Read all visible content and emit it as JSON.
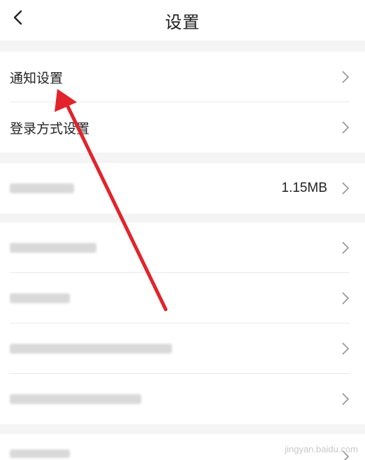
{
  "header": {
    "title": "设置",
    "back_icon": "chevron-left-icon"
  },
  "group1": {
    "items": [
      {
        "label": "通知设置"
      },
      {
        "label": "登录方式设置"
      }
    ]
  },
  "group2": {
    "cache": {
      "label": "",
      "value": "1.15MB"
    }
  },
  "group3": {
    "items": [
      {
        "label": ""
      },
      {
        "label": ""
      },
      {
        "label": ""
      },
      {
        "label": ""
      }
    ]
  },
  "group4": {
    "items": [
      {
        "label": ""
      }
    ]
  },
  "watermark": {
    "text": "jingyan.baidu.com"
  },
  "colors": {
    "arrow": "#e2232b",
    "background": "#f4f4f4",
    "chevron": "#9a9a9a"
  }
}
